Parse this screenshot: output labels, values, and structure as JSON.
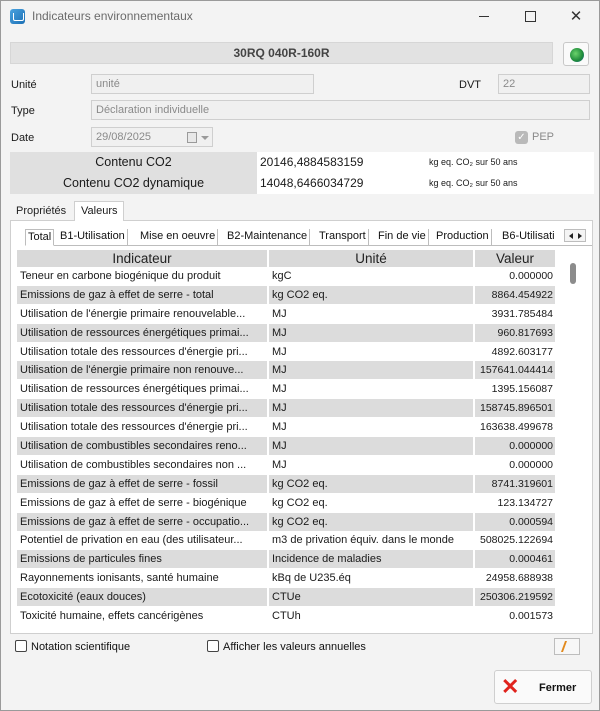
{
  "window": {
    "title": "Indicateurs environnementaux",
    "app_icon": "layers-icon"
  },
  "header": {
    "product_code": "30RQ 040R-160R",
    "globe_icon": "globe-icon"
  },
  "form": {
    "unite_label": "Unité",
    "unite_value": "unité",
    "dvt_label": "DVT",
    "dvt_value": "22",
    "type_label": "Type",
    "type_value": "Déclaration individuelle",
    "date_label": "Date",
    "date_value": "29/08/2025",
    "pep_label": "PEP",
    "pep_checked": true
  },
  "co2": [
    {
      "name": "Contenu CO2",
      "value": "20146,4884583159",
      "unit": "kg eq. CO₂ sur 50 ans"
    },
    {
      "name": "Contenu CO2 dynamique",
      "value": "14048,6466034729",
      "unit": "kg eq. CO₂ sur 50 ans"
    }
  ],
  "outer_tabs": [
    {
      "label": "Propriétés",
      "active": false
    },
    {
      "label": "Valeurs",
      "active": true
    }
  ],
  "inner_tabs": [
    "Total",
    "B1-Utilisation",
    "Mise en oeuvre",
    "B2-Maintenance",
    "Transport",
    "Fin de vie",
    "Production",
    "B6-Utilisati"
  ],
  "grid": {
    "columns": [
      "Indicateur",
      "Unité",
      "Valeur"
    ],
    "rows": [
      {
        "indicateur": "Teneur en carbone biogénique du produit",
        "unite": "kgC",
        "valeur": "0.000000"
      },
      {
        "indicateur": "Emissions de gaz à effet de serre - total",
        "unite": "kg CO2 eq.",
        "valeur": "8864.454922"
      },
      {
        "indicateur": "Utilisation de l'énergie primaire renouvelable...",
        "unite": "MJ",
        "valeur": "3931.785484"
      },
      {
        "indicateur": "Utilisation de ressources énergétiques primai...",
        "unite": "MJ",
        "valeur": "960.817693"
      },
      {
        "indicateur": "Utilisation totale des ressources d'énergie pri...",
        "unite": "MJ",
        "valeur": "4892.603177"
      },
      {
        "indicateur": "Utilisation de l'énergie primaire non renouve...",
        "unite": "MJ",
        "valeur": "157641.044414"
      },
      {
        "indicateur": "Utilisation de ressources énergétiques primai...",
        "unite": "MJ",
        "valeur": "1395.156087"
      },
      {
        "indicateur": "Utilisation totale des ressources d'énergie pri...",
        "unite": "MJ",
        "valeur": "158745.896501"
      },
      {
        "indicateur": "Utilisation totale des ressources d'énergie pri...",
        "unite": "MJ",
        "valeur": "163638.499678"
      },
      {
        "indicateur": "Utilisation de combustibles secondaires reno...",
        "unite": "MJ",
        "valeur": "0.000000"
      },
      {
        "indicateur": "Utilisation de combustibles secondaires non ...",
        "unite": "MJ",
        "valeur": "0.000000"
      },
      {
        "indicateur": "Emissions de gaz à effet de serre - fossil",
        "unite": "kg CO2 eq.",
        "valeur": "8741.319601"
      },
      {
        "indicateur": "Emissions de gaz à effet de serre - biogénique",
        "unite": "kg CO2 eq.",
        "valeur": "123.134727"
      },
      {
        "indicateur": "Emissions de gaz à effet de serre - occupatio...",
        "unite": "kg CO2 eq.",
        "valeur": "0.000594"
      },
      {
        "indicateur": "Potentiel de privation en eau (des utilisateur...",
        "unite": "m3 de privation équiv. dans le monde",
        "valeur": "508025.122694"
      },
      {
        "indicateur": "Emissions de particules fines",
        "unite": "Incidence de maladies",
        "valeur": "0.000461"
      },
      {
        "indicateur": "Rayonnements ionisants, santé humaine",
        "unite": "kBq de U235.éq",
        "valeur": "24958.688938"
      },
      {
        "indicateur": "Ecotoxicité (eaux douces)",
        "unite": "CTUe",
        "valeur": "250306.219592"
      },
      {
        "indicateur": "Toxicité humaine, effets cancérigènes",
        "unite": "CTUh",
        "valeur": "0.001573"
      }
    ]
  },
  "footer": {
    "notation_label": "Notation scientifique",
    "annuelles_label": "Afficher les valeurs annuelles",
    "close_label": "Fermer"
  }
}
